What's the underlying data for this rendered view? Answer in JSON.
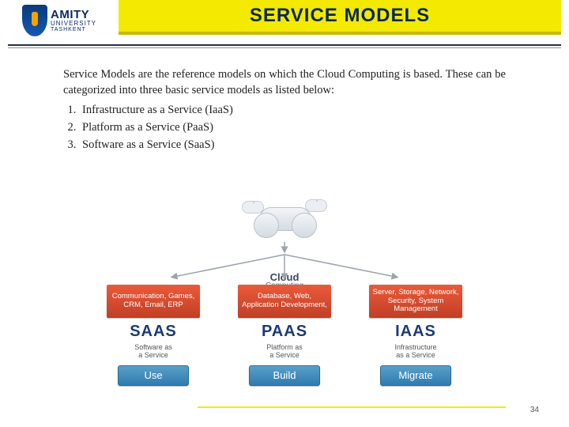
{
  "header": {
    "title": "SERVICE MODELS",
    "logo": {
      "name": "AMITY",
      "sub": "UNIVERSITY",
      "city": "TASHKENT"
    }
  },
  "body": {
    "intro": "Service Models are the reference models on which the Cloud Computing is based. These can be categorized into three basic service models as listed below:",
    "items": [
      "Infrastructure as a Service (IaaS)",
      "Platform as a Service (PaaS)",
      "Software as a Service (SaaS)"
    ]
  },
  "diagram": {
    "cloud_label_top": "Cloud",
    "cloud_label_bottom": "Computing",
    "columns": [
      {
        "red": "Communication, Games, CRM, Email, ERP",
        "abbr": "SAAS",
        "full_l1": "Software as",
        "full_l2": "a Service",
        "action": "Use"
      },
      {
        "red": "Database, Web, Application Development,",
        "abbr": "PAAS",
        "full_l1": "Platform as",
        "full_l2": "a Service",
        "action": "Build"
      },
      {
        "red": "Server, Storage, Network, Security, System Management",
        "abbr": "IAAS",
        "full_l1": "Infrastructure",
        "full_l2": "as a Service",
        "action": "Migrate"
      }
    ]
  },
  "footer": {
    "page": "34"
  }
}
